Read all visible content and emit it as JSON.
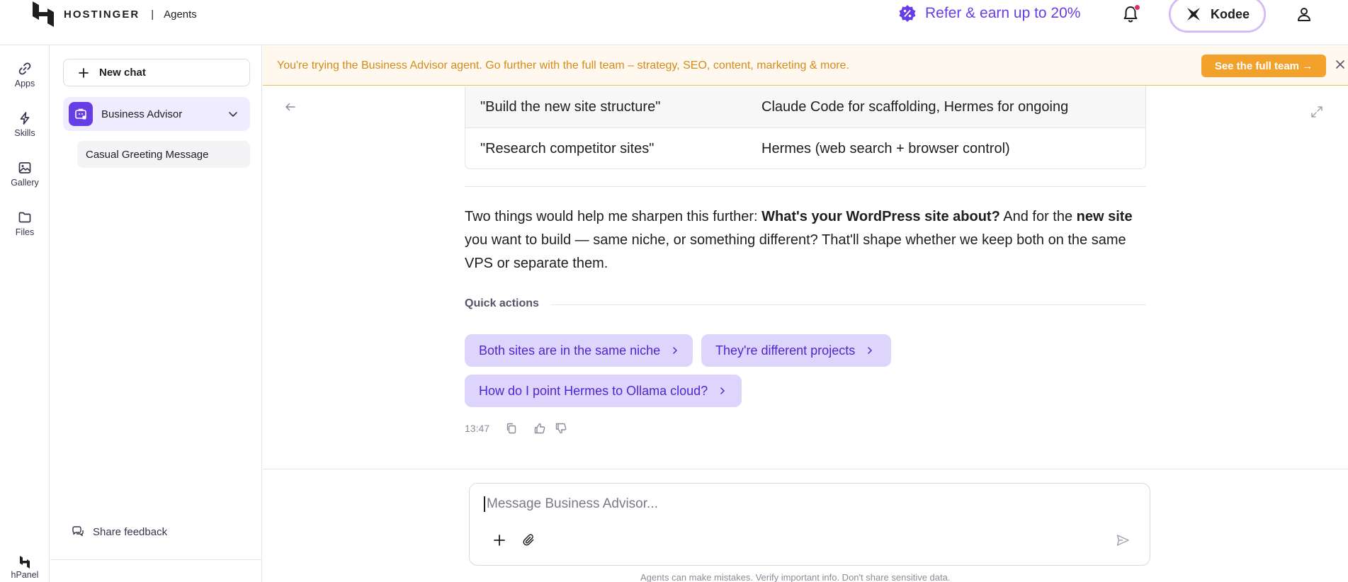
{
  "header": {
    "brand": "HOSTINGER",
    "separator": "|",
    "section": "Agents",
    "refer_label": "Refer & earn up to 20%",
    "kodee_label": "Kodee",
    "accent_color": "#673de6"
  },
  "rail": {
    "items": [
      {
        "label": "Apps",
        "icon": "link-icon"
      },
      {
        "label": "Skills",
        "icon": "bolt-icon"
      },
      {
        "label": "Gallery",
        "icon": "image-icon"
      },
      {
        "label": "Files",
        "icon": "folder-icon"
      }
    ],
    "hpanel_label": "hPanel"
  },
  "sidebar": {
    "new_chat_label": "New chat",
    "agent_name": "Business Advisor",
    "chats": [
      "Casual Greeting Message"
    ],
    "feedback_label": "Share feedback"
  },
  "banner": {
    "text": "You're trying the Business Advisor agent. Go further with the full team – strategy, SEO, content, marketing & more.",
    "button_label": "See the full team →",
    "color": "#f2a22b"
  },
  "table": {
    "rows": [
      {
        "task": "\"Build the new site structure\"",
        "tool": "Claude Code for scaffolding, Hermes for ongoing"
      },
      {
        "task": "\"Research competitor sites\"",
        "tool": "Hermes (web search + browser control)"
      }
    ]
  },
  "message": {
    "part1": "Two things would help me sharpen this further: ",
    "bold1": "What's your WordPress site about?",
    "part2": " And for the ",
    "bold2": "new site",
    "part3": " you want to build — same niche, or something different? That'll shape whether we keep both on the same VPS or separate them."
  },
  "quick_actions": {
    "title": "Quick actions",
    "items": [
      "Both sites are in the same niche",
      "They're different projects",
      "How do I point Hermes to Ollama cloud?"
    ]
  },
  "meta": {
    "time": "13:47"
  },
  "composer": {
    "placeholder": "Message Business Advisor...",
    "value": ""
  },
  "disclaimer": "Agents can make mistakes. Verify important info. Don't share sensitive data."
}
